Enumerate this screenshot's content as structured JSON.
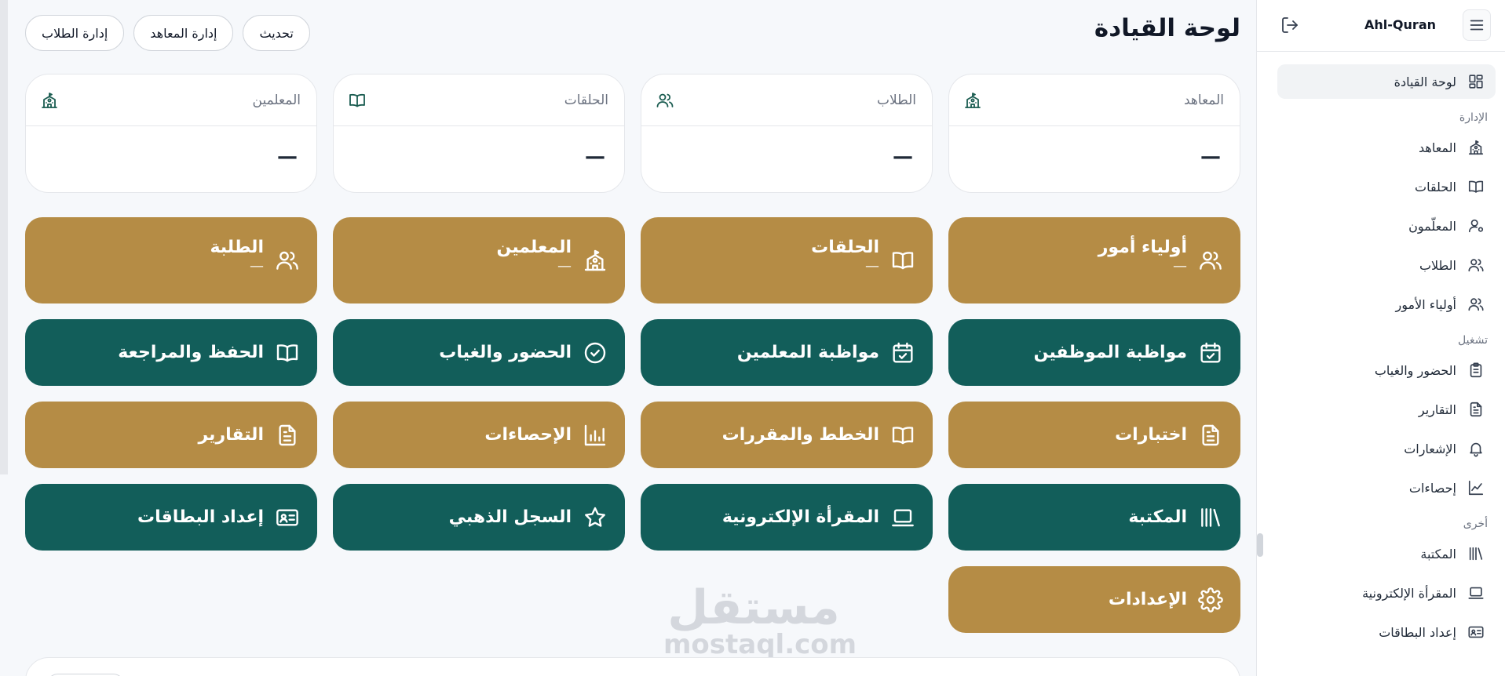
{
  "header": {
    "title": "لوحة القيادة",
    "actions": [
      "تحديث",
      "إدارة المعاهد",
      "إدارة الطلاب"
    ]
  },
  "stats": [
    {
      "label": "المعاهد",
      "icon": "school-icon",
      "value": "—"
    },
    {
      "label": "الطلاب",
      "icon": "users-icon",
      "value": "—"
    },
    {
      "label": "الحلقات",
      "icon": "book-icon",
      "value": "—"
    },
    {
      "label": "المعلمين",
      "icon": "school-icon",
      "value": "—"
    }
  ],
  "tiles_row1": [
    {
      "label": "أولياء أمور",
      "sub": "—",
      "icon": "users-icon"
    },
    {
      "label": "الحلقات",
      "sub": "—",
      "icon": "book-icon"
    },
    {
      "label": "المعلمين",
      "sub": "—",
      "icon": "school-icon"
    },
    {
      "label": "الطلبة",
      "sub": "—",
      "icon": "users-icon"
    }
  ],
  "tiles": [
    {
      "label": "مواظبة الموظفين",
      "icon": "calendar-check-icon",
      "color": "green"
    },
    {
      "label": "مواظبة المعلمين",
      "icon": "calendar-check-icon",
      "color": "green"
    },
    {
      "label": "الحضور والغياب",
      "icon": "check-circle-icon",
      "color": "green"
    },
    {
      "label": "الحفظ والمراجعة",
      "icon": "book-icon",
      "color": "green"
    },
    {
      "label": "اختبارات",
      "icon": "document-icon",
      "color": "gold"
    },
    {
      "label": "الخطط والمقررات",
      "icon": "book-icon",
      "color": "gold"
    },
    {
      "label": "الإحصاءات",
      "icon": "bar-chart-icon",
      "color": "gold"
    },
    {
      "label": "التقارير",
      "icon": "document-icon",
      "color": "gold"
    },
    {
      "label": "المكتبة",
      "icon": "library-icon",
      "color": "green"
    },
    {
      "label": "المقرأة الإلكترونية",
      "icon": "laptop-icon",
      "color": "green"
    },
    {
      "label": "السجل الذهبي",
      "icon": "star-icon",
      "color": "green"
    },
    {
      "label": "إعداد البطاقات",
      "icon": "id-card-icon",
      "color": "green"
    },
    {
      "label": "الإعدادات",
      "icon": "gear-icon",
      "color": "gold"
    }
  ],
  "colors": {
    "gold": "#b58c45",
    "green": "#125e5a"
  },
  "watermark": {
    "ar": "مستقل",
    "en": "mostaql.com"
  },
  "sidebar": {
    "brand": "Ahl-Quran",
    "dashboard": "لوحة القيادة",
    "sections": [
      {
        "title": "الإدارة",
        "items": [
          {
            "label": "المعاهد",
            "icon": "school-icon"
          },
          {
            "label": "الحلقات",
            "icon": "book-icon"
          },
          {
            "label": "المعلّمون",
            "icon": "user-gear-icon"
          },
          {
            "label": "الطلاب",
            "icon": "users-icon"
          },
          {
            "label": "أولياء الأمور",
            "icon": "users-icon"
          }
        ]
      },
      {
        "title": "تشغيل",
        "items": [
          {
            "label": "الحضور والغياب",
            "icon": "clipboard-icon"
          },
          {
            "label": "التقارير",
            "icon": "document-icon"
          },
          {
            "label": "الإشعارات",
            "icon": "bell-icon"
          },
          {
            "label": "إحصاءات",
            "icon": "line-chart-icon"
          }
        ]
      },
      {
        "title": "أخرى",
        "items": [
          {
            "label": "المكتبة",
            "icon": "library-icon"
          },
          {
            "label": "المقرأة الإلكترونية",
            "icon": "laptop-icon"
          },
          {
            "label": "إعداد البطاقات",
            "icon": "id-card-icon"
          }
        ]
      }
    ]
  }
}
